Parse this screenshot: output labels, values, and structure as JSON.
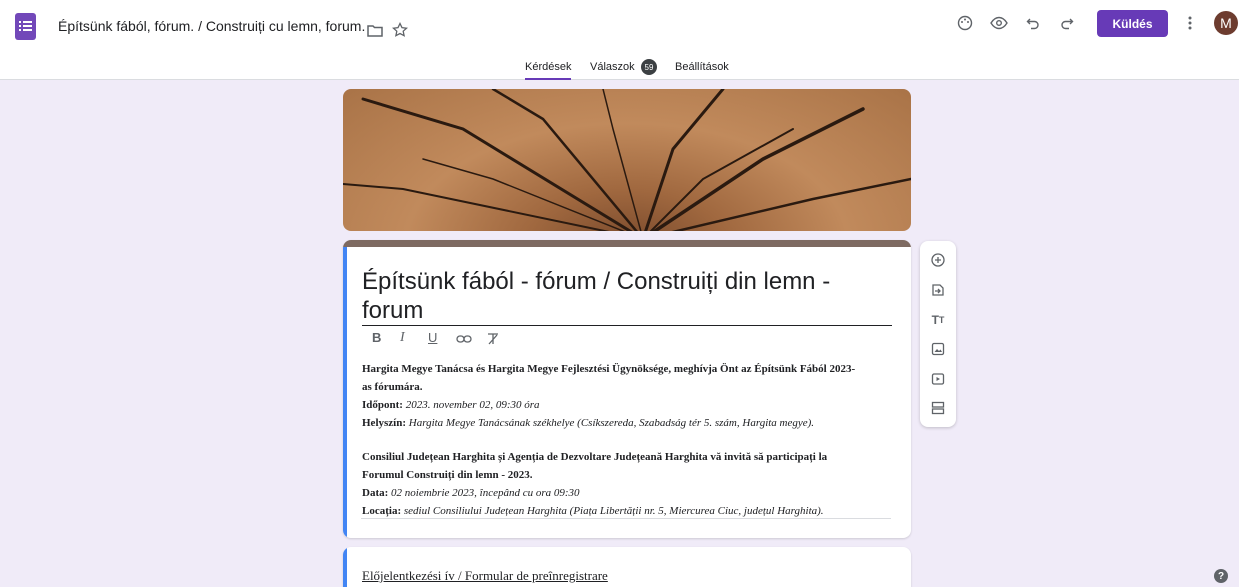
{
  "header": {
    "title": "Építsünk fából, fórum. / Construiți cu lemn, forum.",
    "send_label": "Küldés",
    "avatar_letter": "M"
  },
  "tabs": [
    {
      "label": "Kérdések"
    },
    {
      "label": "Válaszok"
    },
    {
      "label": "Beállítások"
    }
  ],
  "responses_count": "59",
  "form": {
    "title_line1": "Építsünk fából - fórum / Construiți din lemn -",
    "title_line2": "forum",
    "hu_intro_1": "Hargita Megye Tanácsa és Hargita Megye Fejlesztési Ügynöksége, meghívja Önt az Építsünk Fából 2023-",
    "hu_intro_2": "as fórumára.",
    "hu_time_label": "Időpont:",
    "hu_time_value": "2023. november 02, 09:30 óra",
    "hu_place_label": "Helyszín:",
    "hu_place_value": "Hargita Megye Tanácsának székhelye (Csíkszereda, Szabadság tér 5. szám, Hargita megye).",
    "ro_intro_1": "Consiliul Județean Harghita și Agenția de Dezvoltare Județeană Harghita vă invită să participați la",
    "ro_intro_2": "Forumul Construiți din lemn - 2023.",
    "ro_date_label": "Data:",
    "ro_date_value": "02 noiembrie 2023, începând cu ora 09:30",
    "ro_place_label": "Locația:",
    "ro_place_value": "sediul Consiliului Județean Harghita (Piața Libertății nr. 5, Miercurea Ciuc, județul Harghita).",
    "section_title": "Előjelentkezési ív / Formular de preînregistrare"
  },
  "format_toolbar": {
    "bold": "B",
    "italic": "I",
    "underline": "U"
  },
  "colors": {
    "accent": "#673ab7",
    "background": "#f0ebf8",
    "card_stripe": "#7e6a61",
    "focus_stripe": "#4285f4"
  },
  "icons": [
    "form-app-icon",
    "folder-icon",
    "star-icon",
    "palette-icon",
    "preview-eye-icon",
    "undo-icon",
    "redo-icon",
    "more-vert-icon",
    "add-question-icon",
    "import-questions-icon",
    "add-title-icon",
    "add-image-icon",
    "add-video-icon",
    "add-section-icon",
    "link-icon",
    "clear-format-icon",
    "help-icon"
  ]
}
